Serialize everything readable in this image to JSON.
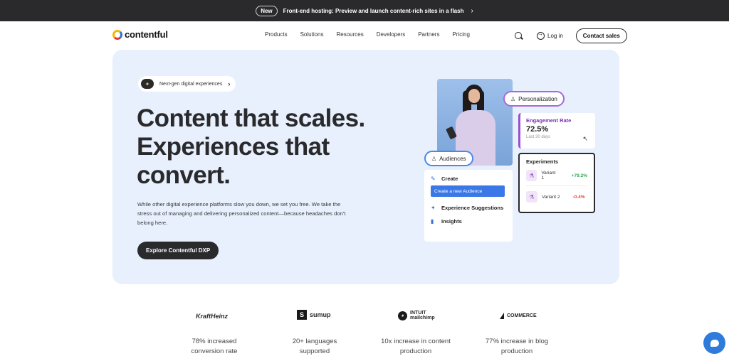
{
  "announcement": {
    "badge": "New",
    "message": "Front-end hosting: Preview and launch content-rich sites in a flash",
    "chevron": "›"
  },
  "nav": {
    "logo_text": "contentful",
    "items": [
      "Products",
      "Solutions",
      "Resources",
      "Developers",
      "Partners",
      "Pricing"
    ],
    "login": "Log in",
    "contact": "Contact sales"
  },
  "hero": {
    "pill": "Next-gen digital experiences",
    "heading_line1": "Content that scales.",
    "heading_line2": "Experiences that",
    "heading_line3": "convert.",
    "subtext": "While other digital experience platforms slow you down, we set you free. We take the stress out of managing and delivering personalized content—because headaches don't belong here.",
    "cta": "Explore Contentful DXP"
  },
  "visual": {
    "personalization_tag": "Personalization",
    "audiences_tag": "Audiences",
    "engagement": {
      "title": "Engagement Rate",
      "value": "72.5%",
      "period": "Last 30 days"
    },
    "experiments": {
      "title": "Experiments",
      "variants": [
        {
          "name": "Variant 1",
          "change": "+79.2%"
        },
        {
          "name": "Variant 2",
          "change": "-0.4%"
        }
      ]
    },
    "actions": {
      "create": "Create",
      "new_audience": "Create a new Audience",
      "suggestions": "Experience Suggestions",
      "insights": "Insights"
    }
  },
  "logos": {
    "kraft": "KraftHeinz",
    "sumup": "sumup",
    "mailchimp_top": "INTUIT",
    "mailchimp": "mailchimp",
    "bigcommerce": "COMMERCE"
  },
  "stats": [
    {
      "line1": "78% increased",
      "line2": "conversion rate"
    },
    {
      "line1": "20+ languages",
      "line2": "supported"
    },
    {
      "line1": "10x increase in content",
      "line2": "production"
    },
    {
      "line1": "77% increase in blog",
      "line2": "production"
    }
  ]
}
